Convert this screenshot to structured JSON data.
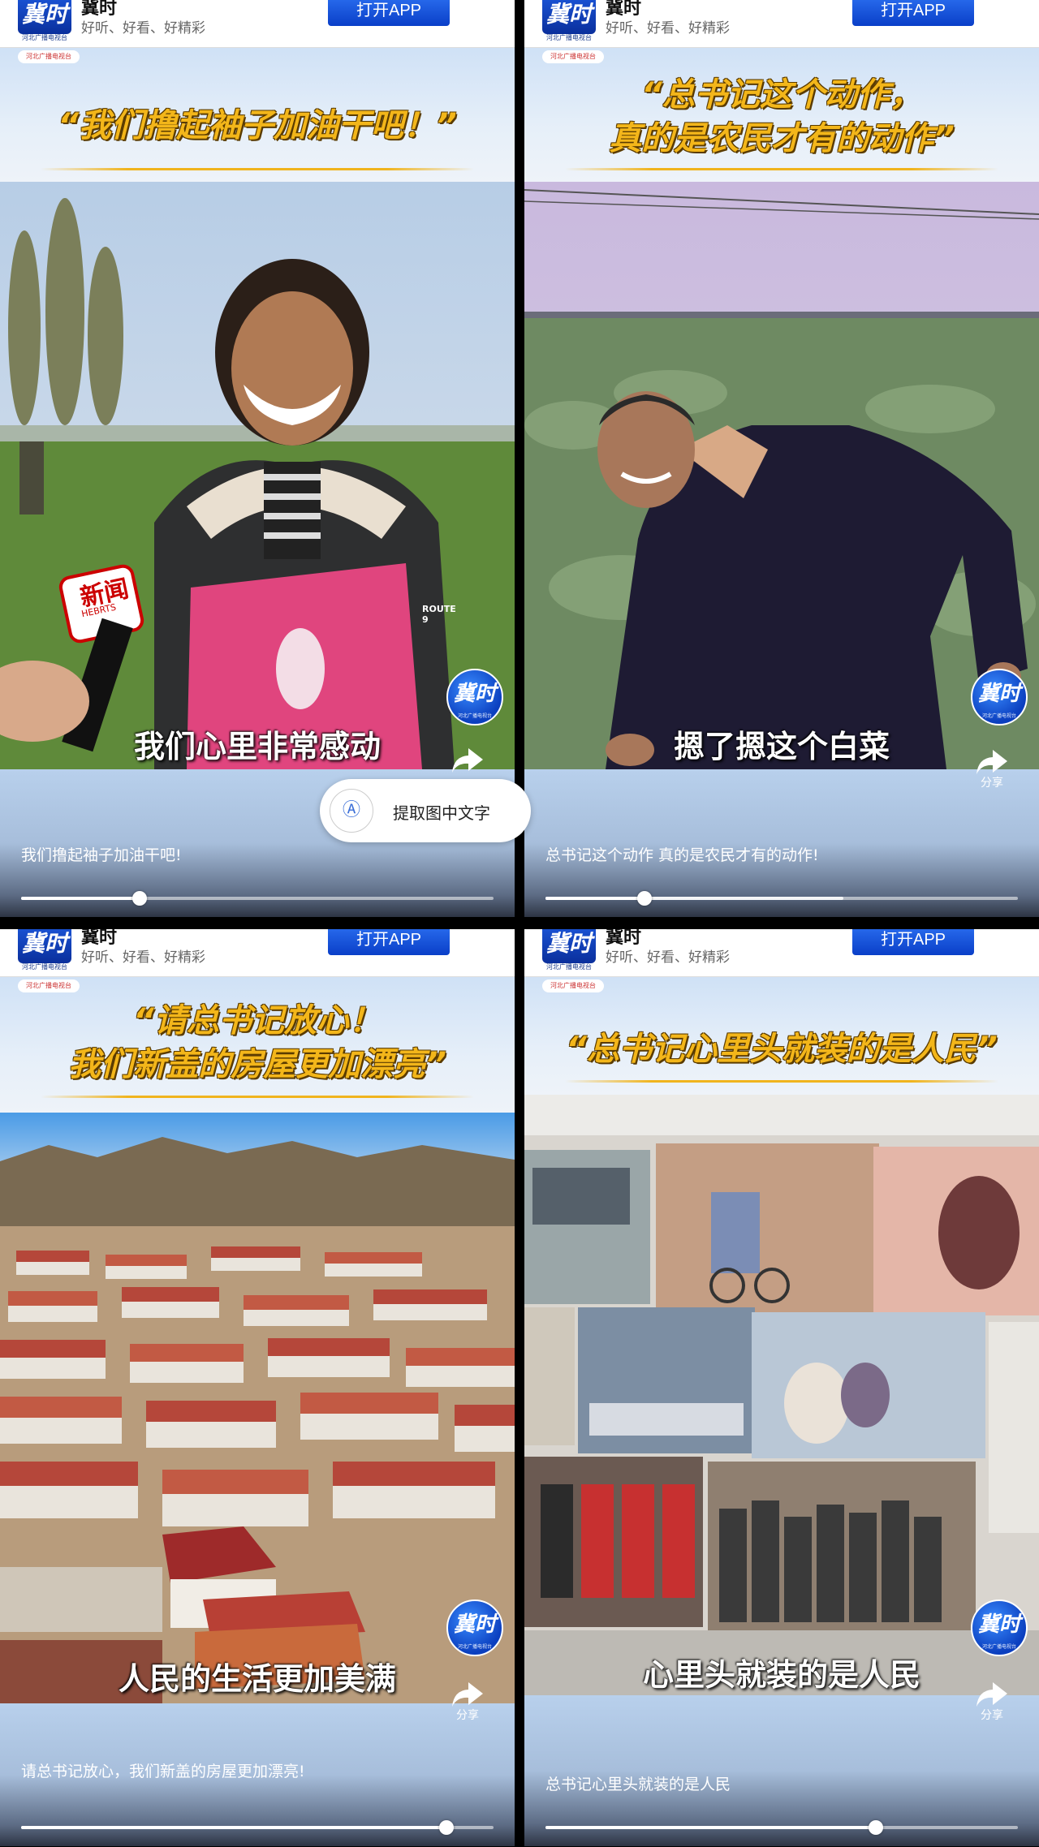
{
  "header": {
    "logo_text": "冀时",
    "logo_sub": "河北广播电视台",
    "app_name": "冀时",
    "slogan": "好听、好看、好精彩",
    "open_app_label": "打开APP"
  },
  "mini_badge": "河北广播电视台",
  "share_label": "分享",
  "corner_logo_text": "冀时",
  "corner_logo_sub": "河北广播电视台",
  "extract_popup": {
    "label": "提取图中文字",
    "icon": "text-recognition-icon"
  },
  "panels": [
    {
      "quote_lines": [
        "“我们撸起袖子加油干吧！”"
      ],
      "subtitle": "我们心里非常感动",
      "mic_text": "新闻",
      "mic_sub": "HEBRTS",
      "apron_text": "ROUTE 9",
      "caption": "我们撸起袖子加油干吧!",
      "progress": 0.25
    },
    {
      "quote_lines": [
        "“总书记这个动作，",
        "真的是农民才有的动作”"
      ],
      "subtitle": "摁了摁这个白菜",
      "caption": "总书记这个动作 真的是农民才有的动作!",
      "progress": 0.21,
      "buffered": 0.63
    },
    {
      "quote_lines": [
        "“请总书记放心！",
        "我们新盖的房屋更加漂亮”"
      ],
      "subtitle": "人民的生活更加美满",
      "caption": "请总书记放心，我们新盖的房屋更加漂亮!",
      "progress": 0.9
    },
    {
      "quote_lines": [
        "“总书记心里头就装的是人民”"
      ],
      "subtitle": "心里头就装的是人民",
      "caption": "总书记心里头就装的是人民",
      "progress": 0.7
    }
  ]
}
